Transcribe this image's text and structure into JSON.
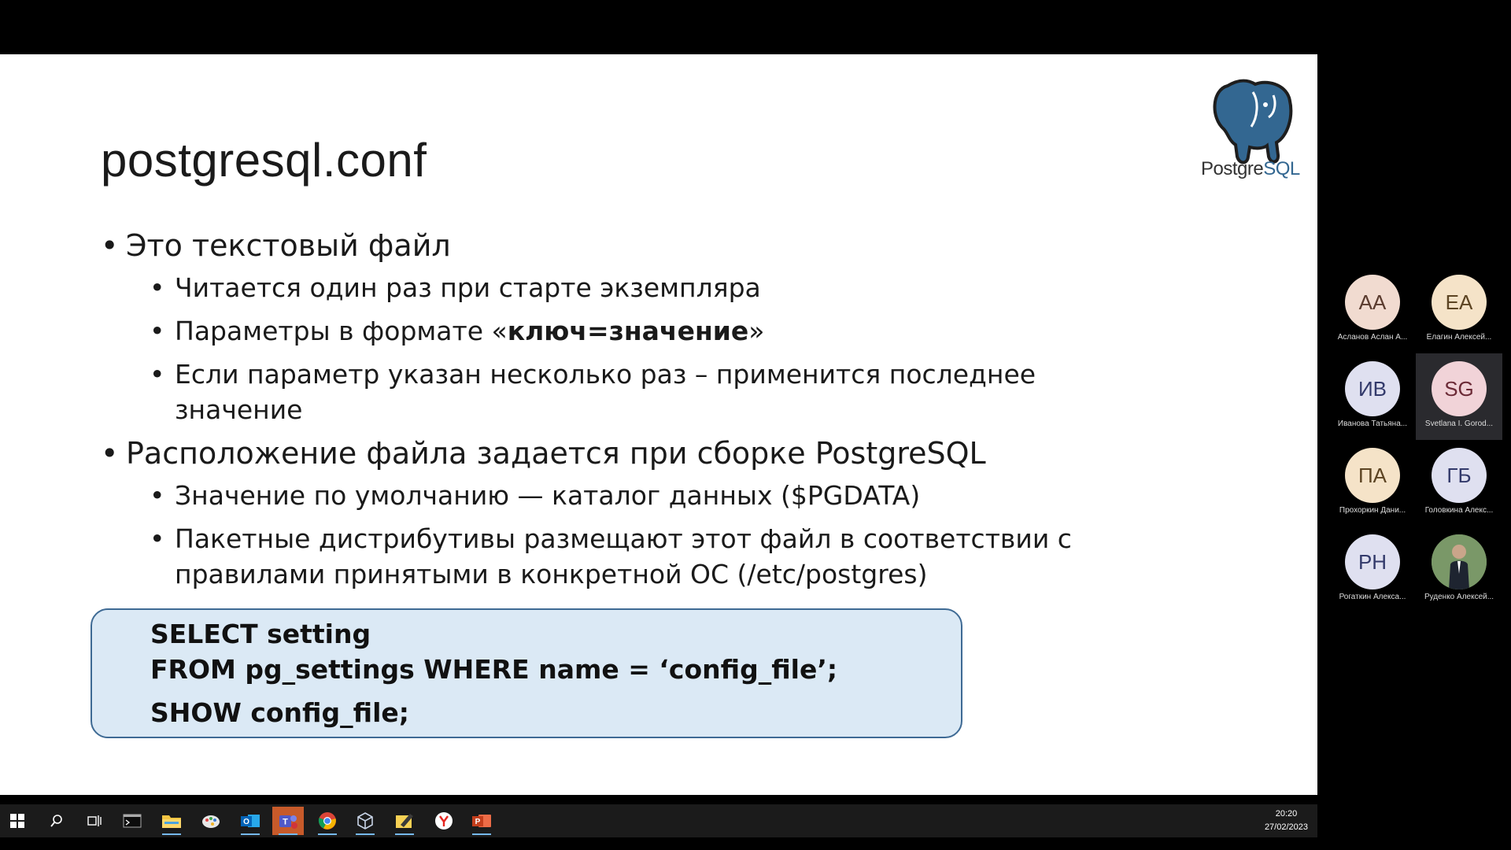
{
  "slide": {
    "title": "postgresql.conf",
    "logo_text_a": "Postgre",
    "logo_text_b": "SQL",
    "bullet1": "Это текстовый файл",
    "bullet1_sub1": "Читается один раз при старте экземпляра",
    "bullet1_sub2_pre": "Параметры в формате «",
    "bullet1_sub2_bold": "ключ=значение",
    "bullet1_sub2_post": "»",
    "bullet1_sub3": "Если параметр указан несколько раз – применится последнее значение",
    "bullet2": "Расположение файла задается при сборке PostgreSQL",
    "bullet2_sub1": "Значение по умолчанию — каталог данных ($PGDATA)",
    "bullet2_sub2": "Пакетные дистрибутивы размещают этот файл в соответствии с правилами принятыми в конкретной ОС (/etc/postgres)",
    "code_line1": "SELECT setting",
    "code_line2": "FROM pg_settings WHERE name = ‘config_file’;",
    "code_line3": "SHOW config_file;"
  },
  "participants": [
    {
      "initials": "АА",
      "name": "Асланов Аслан А...",
      "bg": "#f1dbd0",
      "fg": "#5a3b2e"
    },
    {
      "initials": "ЕА",
      "name": "Елагин Алексей...",
      "bg": "#f5e3c8",
      "fg": "#5c4423"
    },
    {
      "initials": "ИВ",
      "name": "Иванова Татьяна...",
      "bg": "#dfe0f0",
      "fg": "#333a6b"
    },
    {
      "initials": "SG",
      "name": "Svetlana I. Gorod...",
      "bg": "#f1d3d8",
      "fg": "#6b2a36"
    },
    {
      "initials": "ПА",
      "name": "Прохоркин Дани...",
      "bg": "#f5e3c8",
      "fg": "#5c4423"
    },
    {
      "initials": "ГБ",
      "name": "Головкина Алекс...",
      "bg": "#dfe0f0",
      "fg": "#333a6b"
    },
    {
      "initials": "РН",
      "name": "Рогаткин Алекса...",
      "bg": "#dfe0f0",
      "fg": "#333a6b"
    },
    {
      "initials": "",
      "name": "Руденко Алексей...",
      "bg": "#6c8a5a",
      "fg": "#ffffff"
    }
  ],
  "taskbar": {
    "time": "20:20",
    "date": "27/02/2023",
    "icons": [
      "windows-start-icon",
      "search-icon",
      "task-view-icon",
      "terminal-icon",
      "file-explorer-icon",
      "paint-icon",
      "outlook-icon",
      "teams-icon",
      "chrome-icon",
      "virtualbox-icon",
      "sticky-notes-icon",
      "yandex-browser-icon",
      "powerpoint-icon"
    ]
  },
  "colors": {
    "code_box_bg": "#dbe9f5",
    "code_box_border": "#3e6a94",
    "postgres_blue": "#336791"
  }
}
